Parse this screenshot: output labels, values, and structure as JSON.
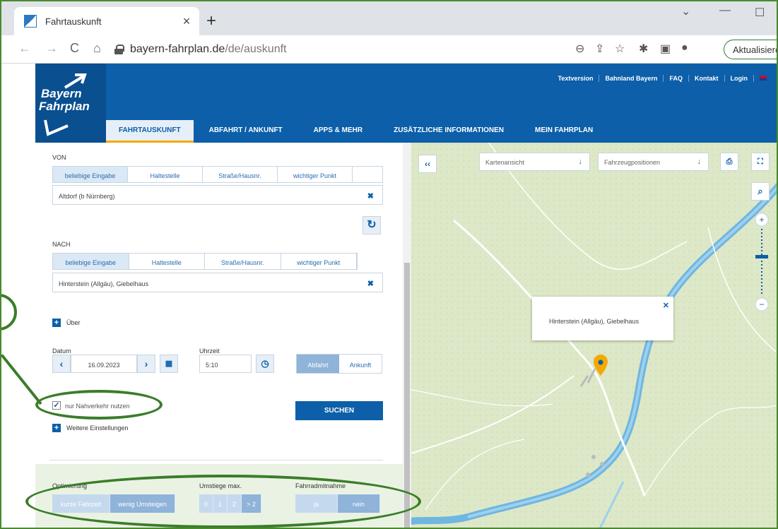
{
  "browser": {
    "tab_title": "Fahrtauskunft",
    "tab_close": "×",
    "new_tab": "+",
    "url_domain": "bayern-fahrplan.de",
    "url_path": "/de/auskunft",
    "update_button": "Aktualisieren"
  },
  "site": {
    "logo_line1": "Bayern",
    "logo_line2": "Fahrplan",
    "top_links": [
      "Textversion",
      "Bahnland Bayern",
      "FAQ",
      "Kontakt",
      "Login"
    ],
    "nav": [
      "FAHRTAUSKUNFT",
      "ABFAHRT / ANKUNFT",
      "APPS & MEHR",
      "ZUSÄTZLICHE INFORMATIONEN",
      "MEIN FAHRPLAN"
    ]
  },
  "form": {
    "von_label": "VON",
    "nach_label": "NACH",
    "input_types": [
      "beliebige Eingabe",
      "Haltestelle",
      "Straße/Hausnr.",
      "wichtiger Punkt"
    ],
    "von_value": "Altdorf (b Nürnberg)",
    "nach_value": "Hinterstein (Allgäu), Giebelhaus",
    "ueber_label": "Über",
    "datum_label": "Datum",
    "datum_value": "16.09.2023",
    "uhrzeit_label": "Uhrzeit",
    "uhrzeit_value": "5:10",
    "abfahrt": "Abfahrt",
    "ankunft": "Ankunft",
    "nahverkehr_label": "nur Nahverkehr nutzen",
    "suchen": "SUCHEN",
    "weitere_label": "Weitere Einstellungen",
    "optimierung_label": "Optimierung",
    "optimierung_options": [
      "kurze Fahrzeit",
      "wenig Umsteigen"
    ],
    "umstiege_label": "Umstiege max.",
    "umstiege_options": [
      "0",
      "1",
      "2",
      "> 2"
    ],
    "fahrrad_label": "Fahrradmitnahme",
    "fahrrad_options": [
      "ja",
      "nein"
    ]
  },
  "map": {
    "collapse_btn": "‹‹",
    "view_select": "Kartenansicht",
    "vehicle_select": "Fahrzeugpositionen",
    "popup_text": "Hinterstein (Allgäu), Giebelhaus"
  }
}
